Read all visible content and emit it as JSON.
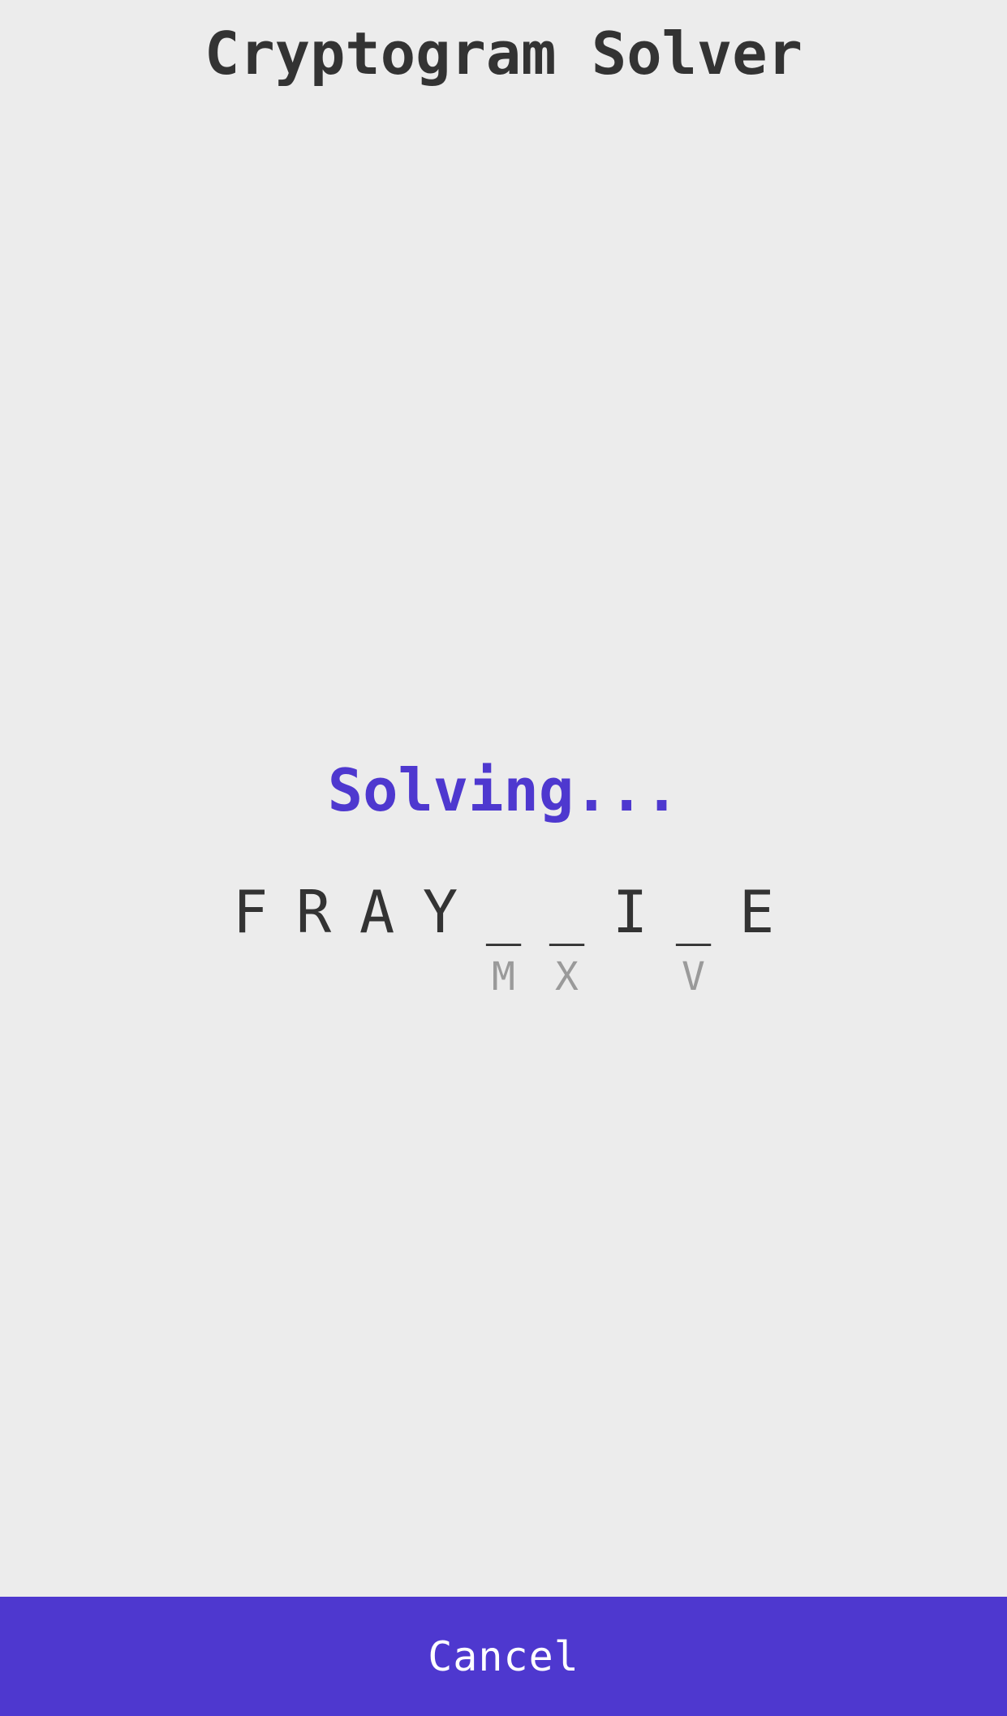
{
  "app": {
    "title": "Cryptogram Solver"
  },
  "status": {
    "text": "Solving..."
  },
  "puzzle": {
    "cells": [
      {
        "letter": "F",
        "hint": ""
      },
      {
        "letter": "R",
        "hint": ""
      },
      {
        "letter": "A",
        "hint": ""
      },
      {
        "letter": "Y",
        "hint": ""
      },
      {
        "letter": "_",
        "hint": "M"
      },
      {
        "letter": "_",
        "hint": "X"
      },
      {
        "letter": "I",
        "hint": ""
      },
      {
        "letter": "_",
        "hint": "V"
      },
      {
        "letter": "E",
        "hint": ""
      }
    ]
  },
  "actions": {
    "cancel_label": "Cancel"
  },
  "colors": {
    "background": "#ececec",
    "accent": "#4e38cf",
    "text": "#333333",
    "hint": "#9a9a9a"
  }
}
